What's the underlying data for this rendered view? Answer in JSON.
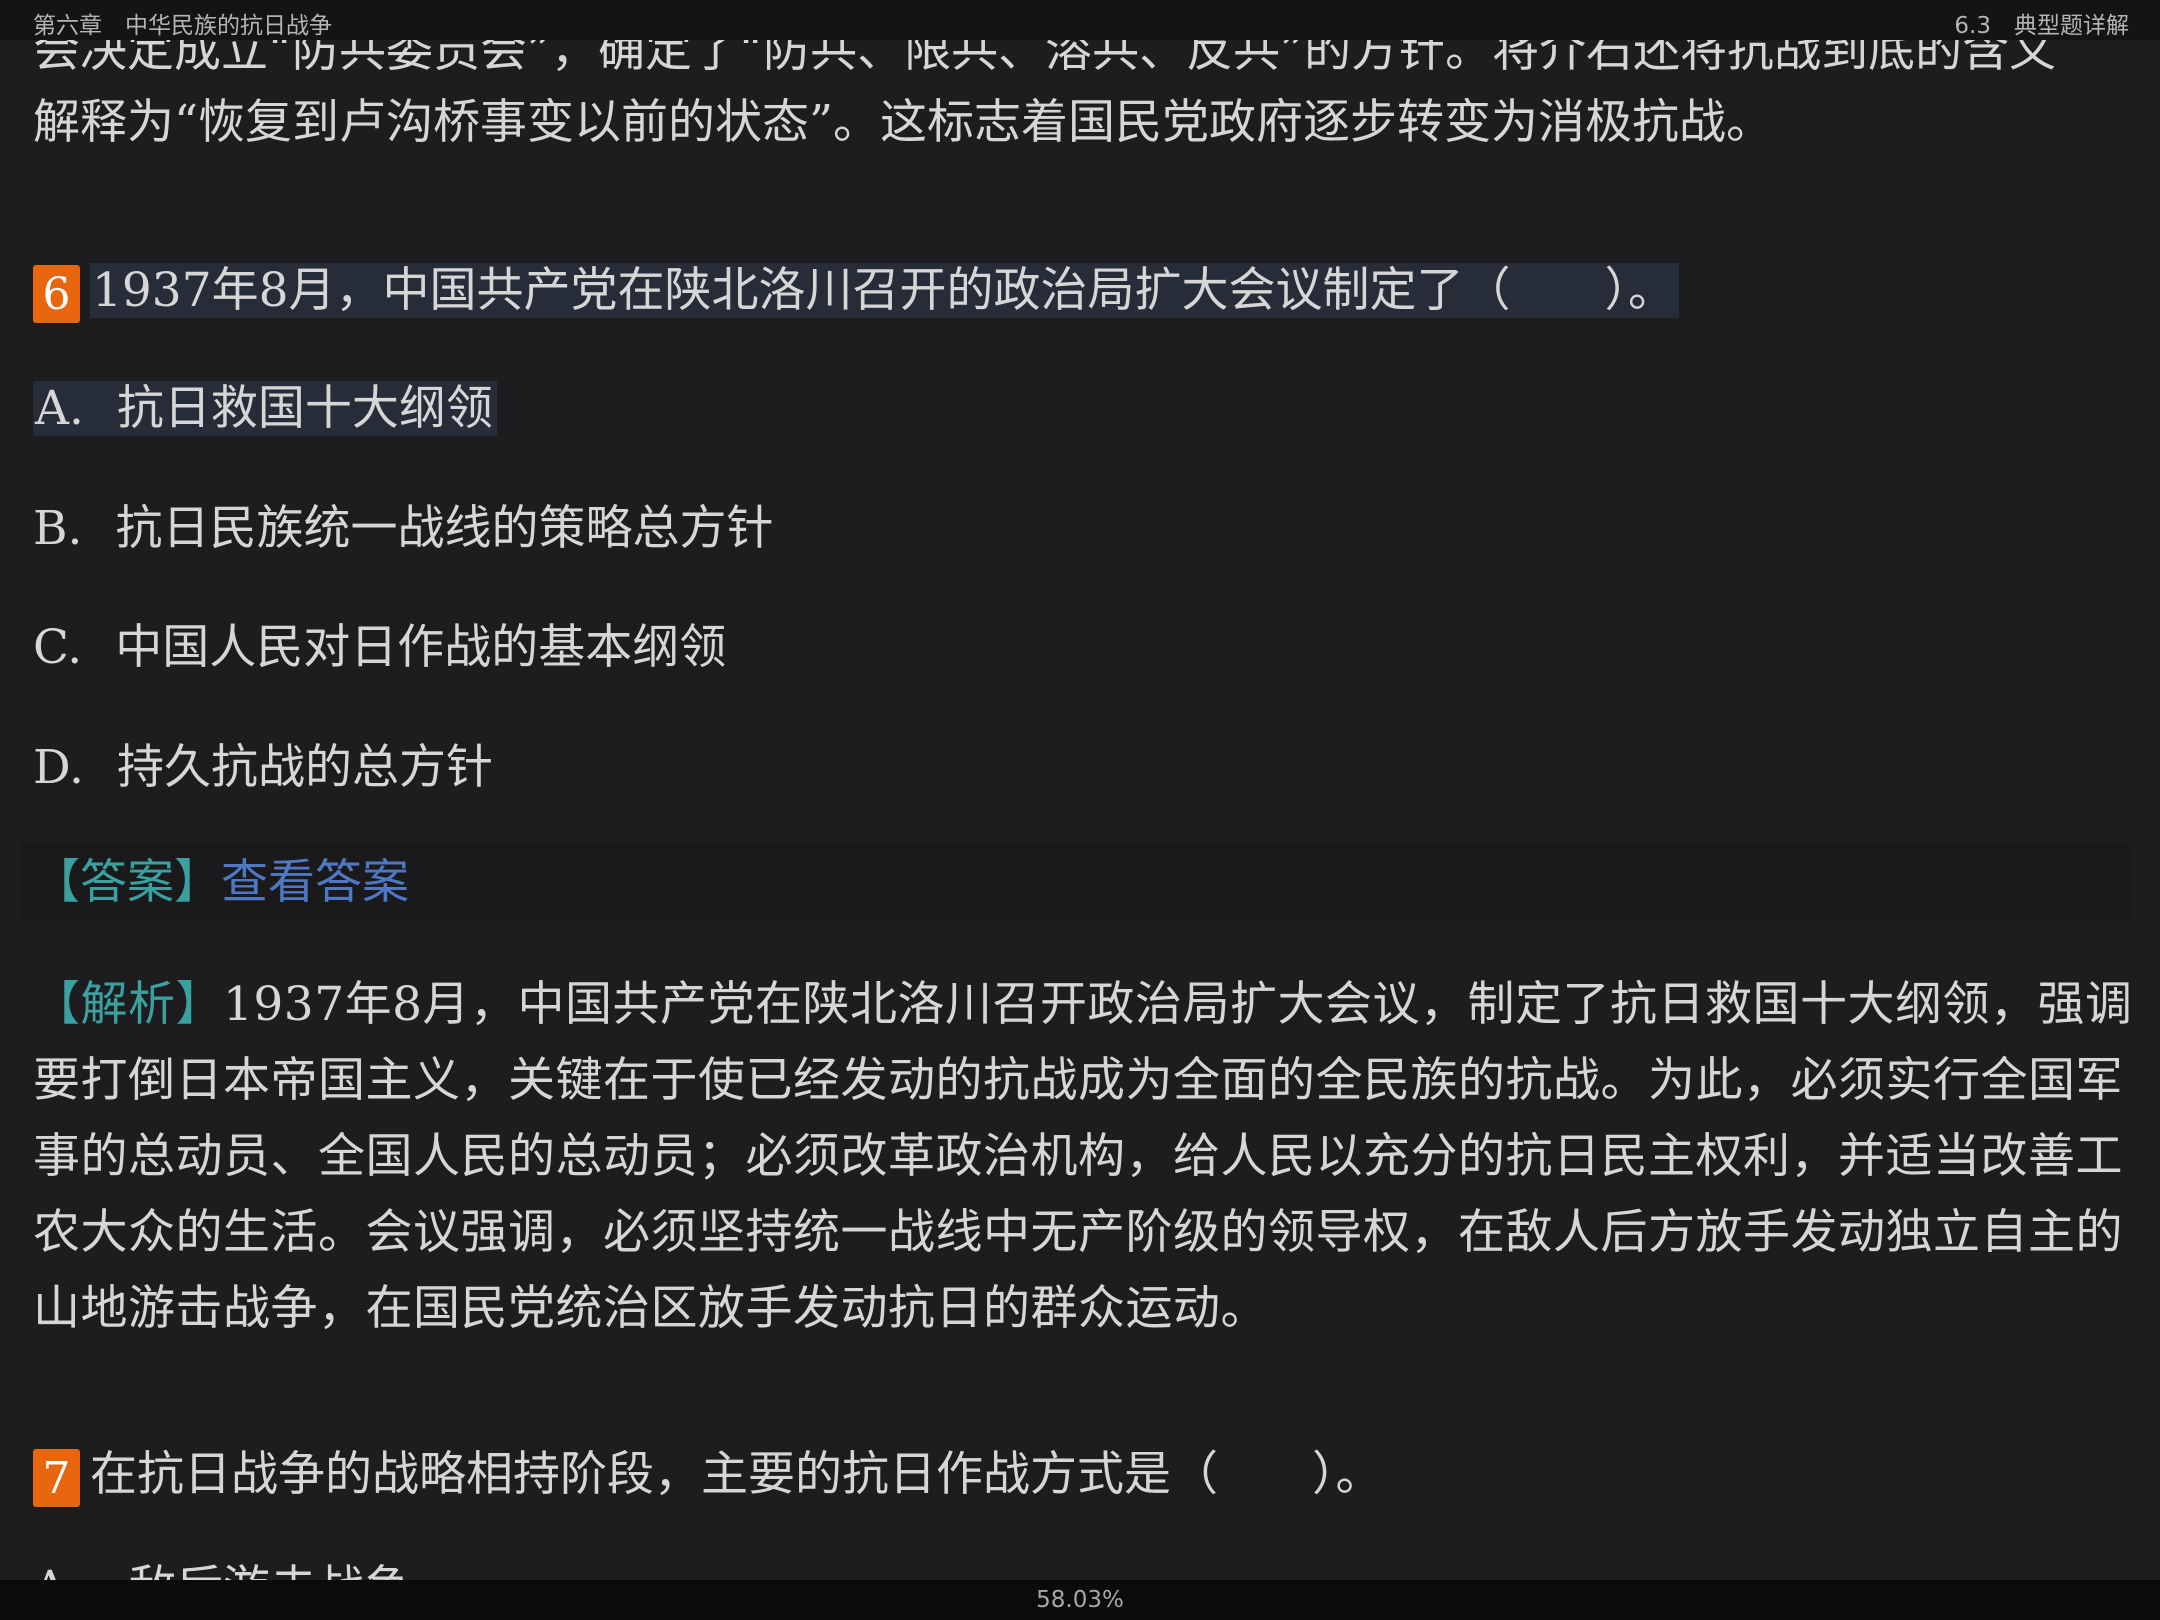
{
  "header": {
    "chapter": "第六章　中华民族的抗日战争",
    "section": "6.3　典型题详解"
  },
  "prev_text": {
    "line1": "会决定成立“防共委员会”，确定了“防共、限共、溶共、反共”的方针。将介石还将抗战到底的含义",
    "line2": "解释为“恢复到卢沟桥事变以前的状态”。这标志着国民党政府逐步转变为消极抗战。"
  },
  "q6": {
    "number": "6",
    "stem": "1937年8月，中国共产党在陕北洛川召开的政治局扩大会议制定了（　　）。",
    "options": [
      {
        "letter": "A.",
        "text": "抗日救国十大纲领"
      },
      {
        "letter": "B.",
        "text": "抗日民族统一战线的策略总方针"
      },
      {
        "letter": "C.",
        "text": "中国人民对日作战的基本纲领"
      },
      {
        "letter": "D.",
        "text": "持久抗战的总方针"
      }
    ],
    "answer_label": "【答案】",
    "answer_link": "查看答案",
    "analysis_label": "【解析】",
    "analysis_text": "1937年8月，中国共产党在陕北洛川召开政治局扩大会议，制定了抗日救国十大纲领，强调要打倒日本帝国主义，关键在于使已经发动的抗战成为全面的全民族的抗战。为此，必须实行全国军事的总动员、全国人民的总动员；必须改革政治机构，给人民以充分的抗日民主权利，并适当改善工农大众的生活。会议强调，必须坚持统一战线中无产阶级的领导权，在敌人后方放手发动独立自主的山地游击战争，在国民党统治区放手发动抗日的群众运动。"
  },
  "q7": {
    "number": "7",
    "stem": "在抗日战争的战略相持阶段，主要的抗日作战方式是（　　）。",
    "partial_option": "A.　敌后游击战争"
  },
  "footer": {
    "progress": "58.03%"
  },
  "colors": {
    "background": "#1d1d1f",
    "question_badge": "#e8660d",
    "highlight": "#262d38",
    "label_teal": "#3aa0a0",
    "link_blue": "#4f78c4"
  }
}
